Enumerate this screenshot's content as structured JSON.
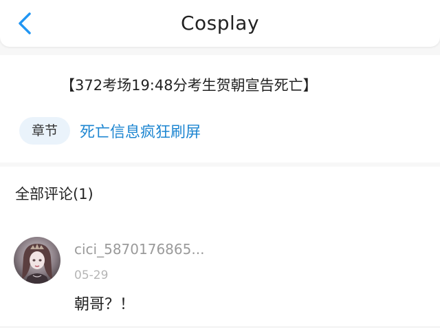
{
  "header": {
    "title": "Cosplay",
    "back_icon": "chevron-left-icon",
    "accent_color": "#2196f3"
  },
  "post": {
    "title": "【372考场19:48分考生贺朝宣告死亡】",
    "chapter_label": "章节",
    "chapter_name": "死亡信息疯狂刷屏",
    "link_color": "#1d86d1"
  },
  "comments": {
    "heading": "全部评论(1)",
    "items": [
      {
        "username": "cici_5870176865...",
        "date": "05-29",
        "text": "朝哥？！"
      }
    ]
  }
}
